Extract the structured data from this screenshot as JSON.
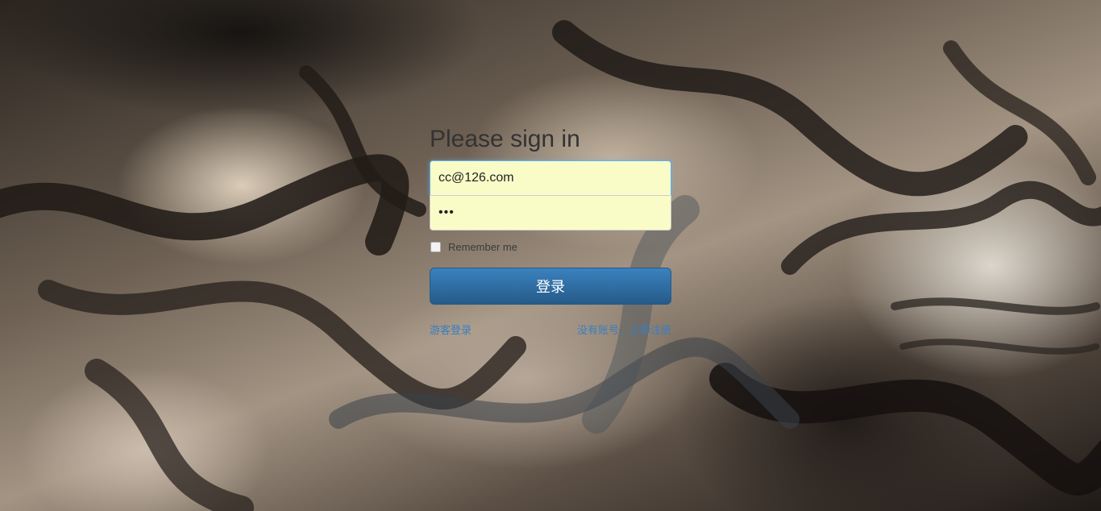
{
  "login": {
    "title": "Please sign in",
    "email_value": "cc@126.com",
    "password_value": "•••",
    "remember_label": "Remember me",
    "submit_label": "登录",
    "guest_link": "游客登录",
    "register_link": "没有账号，立即注册"
  }
}
